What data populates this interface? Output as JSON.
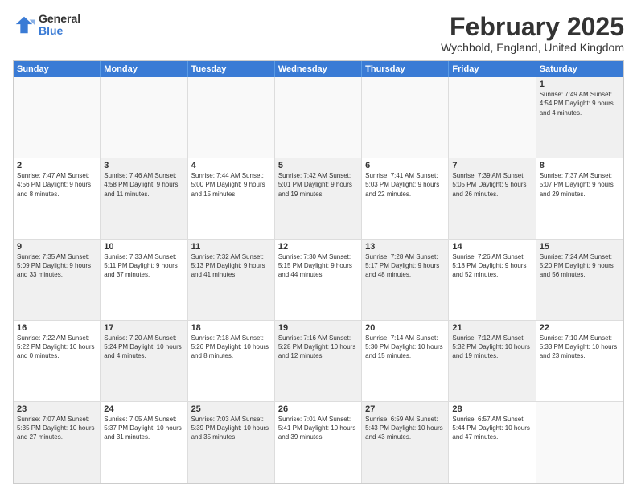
{
  "logo": {
    "general": "General",
    "blue": "Blue"
  },
  "header": {
    "title": "February 2025",
    "subtitle": "Wychbold, England, United Kingdom"
  },
  "days": [
    "Sunday",
    "Monday",
    "Tuesday",
    "Wednesday",
    "Thursday",
    "Friday",
    "Saturday"
  ],
  "weeks": [
    [
      {
        "num": "",
        "info": "",
        "empty": true
      },
      {
        "num": "",
        "info": "",
        "empty": true
      },
      {
        "num": "",
        "info": "",
        "empty": true
      },
      {
        "num": "",
        "info": "",
        "empty": true
      },
      {
        "num": "",
        "info": "",
        "empty": true
      },
      {
        "num": "",
        "info": "",
        "empty": true
      },
      {
        "num": "1",
        "info": "Sunrise: 7:49 AM\nSunset: 4:54 PM\nDaylight: 9 hours and 4 minutes.",
        "shaded": true
      }
    ],
    [
      {
        "num": "2",
        "info": "Sunrise: 7:47 AM\nSunset: 4:56 PM\nDaylight: 9 hours and 8 minutes.",
        "shaded": false
      },
      {
        "num": "3",
        "info": "Sunrise: 7:46 AM\nSunset: 4:58 PM\nDaylight: 9 hours and 11 minutes.",
        "shaded": true
      },
      {
        "num": "4",
        "info": "Sunrise: 7:44 AM\nSunset: 5:00 PM\nDaylight: 9 hours and 15 minutes.",
        "shaded": false
      },
      {
        "num": "5",
        "info": "Sunrise: 7:42 AM\nSunset: 5:01 PM\nDaylight: 9 hours and 19 minutes.",
        "shaded": true
      },
      {
        "num": "6",
        "info": "Sunrise: 7:41 AM\nSunset: 5:03 PM\nDaylight: 9 hours and 22 minutes.",
        "shaded": false
      },
      {
        "num": "7",
        "info": "Sunrise: 7:39 AM\nSunset: 5:05 PM\nDaylight: 9 hours and 26 minutes.",
        "shaded": true
      },
      {
        "num": "8",
        "info": "Sunrise: 7:37 AM\nSunset: 5:07 PM\nDaylight: 9 hours and 29 minutes.",
        "shaded": false
      }
    ],
    [
      {
        "num": "9",
        "info": "Sunrise: 7:35 AM\nSunset: 5:09 PM\nDaylight: 9 hours and 33 minutes.",
        "shaded": true
      },
      {
        "num": "10",
        "info": "Sunrise: 7:33 AM\nSunset: 5:11 PM\nDaylight: 9 hours and 37 minutes.",
        "shaded": false
      },
      {
        "num": "11",
        "info": "Sunrise: 7:32 AM\nSunset: 5:13 PM\nDaylight: 9 hours and 41 minutes.",
        "shaded": true
      },
      {
        "num": "12",
        "info": "Sunrise: 7:30 AM\nSunset: 5:15 PM\nDaylight: 9 hours and 44 minutes.",
        "shaded": false
      },
      {
        "num": "13",
        "info": "Sunrise: 7:28 AM\nSunset: 5:17 PM\nDaylight: 9 hours and 48 minutes.",
        "shaded": true
      },
      {
        "num": "14",
        "info": "Sunrise: 7:26 AM\nSunset: 5:18 PM\nDaylight: 9 hours and 52 minutes.",
        "shaded": false
      },
      {
        "num": "15",
        "info": "Sunrise: 7:24 AM\nSunset: 5:20 PM\nDaylight: 9 hours and 56 minutes.",
        "shaded": true
      }
    ],
    [
      {
        "num": "16",
        "info": "Sunrise: 7:22 AM\nSunset: 5:22 PM\nDaylight: 10 hours and 0 minutes.",
        "shaded": false
      },
      {
        "num": "17",
        "info": "Sunrise: 7:20 AM\nSunset: 5:24 PM\nDaylight: 10 hours and 4 minutes.",
        "shaded": true
      },
      {
        "num": "18",
        "info": "Sunrise: 7:18 AM\nSunset: 5:26 PM\nDaylight: 10 hours and 8 minutes.",
        "shaded": false
      },
      {
        "num": "19",
        "info": "Sunrise: 7:16 AM\nSunset: 5:28 PM\nDaylight: 10 hours and 12 minutes.",
        "shaded": true
      },
      {
        "num": "20",
        "info": "Sunrise: 7:14 AM\nSunset: 5:30 PM\nDaylight: 10 hours and 15 minutes.",
        "shaded": false
      },
      {
        "num": "21",
        "info": "Sunrise: 7:12 AM\nSunset: 5:32 PM\nDaylight: 10 hours and 19 minutes.",
        "shaded": true
      },
      {
        "num": "22",
        "info": "Sunrise: 7:10 AM\nSunset: 5:33 PM\nDaylight: 10 hours and 23 minutes.",
        "shaded": false
      }
    ],
    [
      {
        "num": "23",
        "info": "Sunrise: 7:07 AM\nSunset: 5:35 PM\nDaylight: 10 hours and 27 minutes.",
        "shaded": true
      },
      {
        "num": "24",
        "info": "Sunrise: 7:05 AM\nSunset: 5:37 PM\nDaylight: 10 hours and 31 minutes.",
        "shaded": false
      },
      {
        "num": "25",
        "info": "Sunrise: 7:03 AM\nSunset: 5:39 PM\nDaylight: 10 hours and 35 minutes.",
        "shaded": true
      },
      {
        "num": "26",
        "info": "Sunrise: 7:01 AM\nSunset: 5:41 PM\nDaylight: 10 hours and 39 minutes.",
        "shaded": false
      },
      {
        "num": "27",
        "info": "Sunrise: 6:59 AM\nSunset: 5:43 PM\nDaylight: 10 hours and 43 minutes.",
        "shaded": true
      },
      {
        "num": "28",
        "info": "Sunrise: 6:57 AM\nSunset: 5:44 PM\nDaylight: 10 hours and 47 minutes.",
        "shaded": false
      },
      {
        "num": "",
        "info": "",
        "empty": true
      }
    ]
  ]
}
